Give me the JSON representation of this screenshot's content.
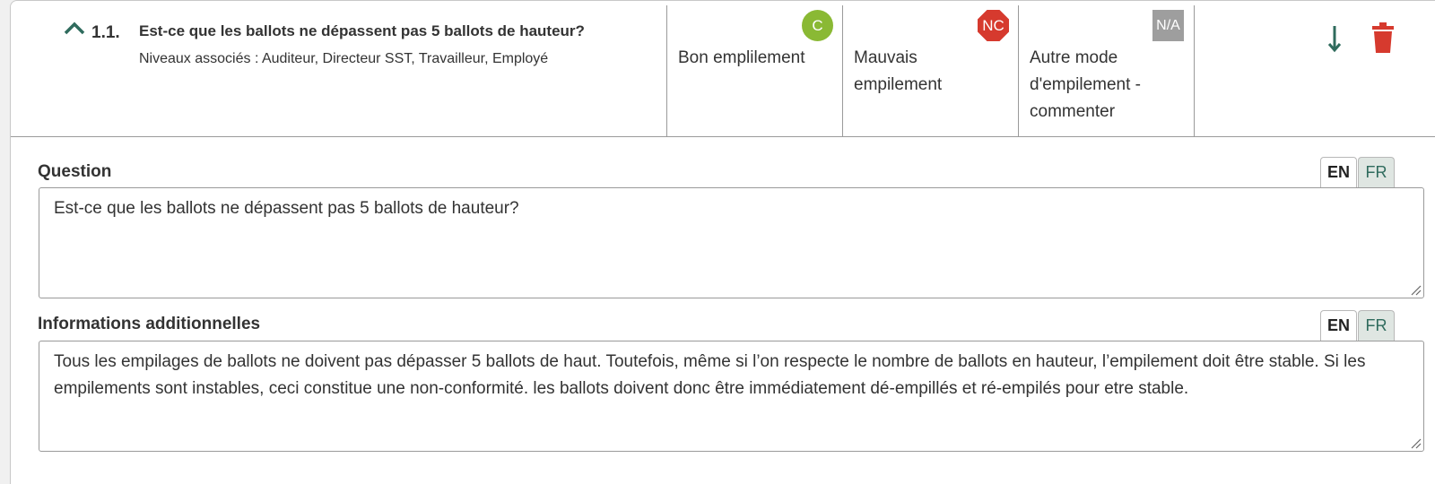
{
  "question_row": {
    "number": "1.1.",
    "title": "Est-ce que les ballots ne dépassent pas 5 ballots de hauteur?",
    "levels_label": "Niveaux associés :",
    "levels_value": "Auditeur, Directeur SST, Travailleur, Employé",
    "options": [
      {
        "badge": "C",
        "text": "Bon emplilement",
        "color": "#8ab934"
      },
      {
        "badge": "NC",
        "text": "Mauvais empilement",
        "color": "#d63a2e"
      },
      {
        "badge": "N/A",
        "text": "Autre mode d'empilement - commenter",
        "color": "#9e9e9e"
      }
    ]
  },
  "question_section": {
    "label": "Question",
    "value": "Est-ce que les ballots ne dépassent pas 5 ballots de hauteur?",
    "lang_en": "EN",
    "lang_fr": "FR"
  },
  "info_section": {
    "label": "Informations additionnelles",
    "value": "Tous les empilages de ballots ne doivent pas dépasser 5 ballots de haut.  Toutefois, même si l’on respecte le nombre de ballots en hauteur, l’empilement doit être stable.  Si les empilements sont instables, ceci constitue une non-conformité.  les ballots doivent donc être immédiatement dé-empillés et ré-empilés pour etre stable.",
    "lang_en": "EN",
    "lang_fr": "FR"
  },
  "colors": {
    "accent": "#2f6b5d",
    "delete": "#d63a2e"
  },
  "icons": [
    "chevron-up-icon",
    "arrow-down-icon",
    "trash-icon",
    "resize-handle-icon"
  ]
}
